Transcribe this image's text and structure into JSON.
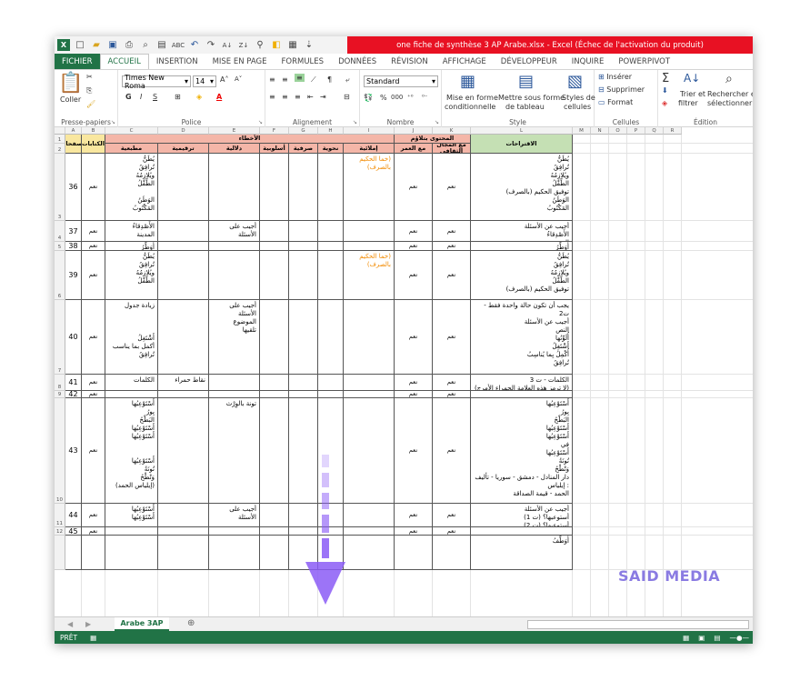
{
  "app": {
    "title": "one fiche de synthèse  3 AP Arabe.xlsx  -  Excel (Échec de l'activation du produit)",
    "logo": "X"
  },
  "qat": {
    "icons": [
      "new-file-icon",
      "open-folder-icon",
      "save-icon",
      "print-icon",
      "preview-icon",
      "print-preview-icon",
      "spelling-icon",
      "undo-icon",
      "redo-icon",
      "sort-asc-icon",
      "sort-desc-icon",
      "filter-icon",
      "fill-color-icon",
      "border-icon",
      "customize-icon"
    ]
  },
  "tabs": [
    "FICHIER",
    "ACCUEIL",
    "INSERTION",
    "MISE EN PAGE",
    "FORMULES",
    "DONNÉES",
    "RÉVISION",
    "AFFICHAGE",
    "DÉVELOPPEUR",
    "INQUIRE",
    "POWERPIVOT"
  ],
  "ribbon": {
    "paste_label": "Coller",
    "clipboard_label": "Presse-papiers",
    "font_name": "Times New Roma",
    "font_size": "14",
    "font_group_label": "Police",
    "bold": "G",
    "italic": "I",
    "underline": "S",
    "alignment_label": "Alignement",
    "number_format": "Standard",
    "percent": "%",
    "thousands": "000",
    "number_label": "Nombre",
    "cond_format_1": "Mise en forme",
    "cond_format_2": "conditionnelle",
    "table_format_1": "Mettre sous forme",
    "table_format_2": "de tableau",
    "cell_styles_1": "Styles de",
    "cell_styles_2": "cellules",
    "styles_label": "Style",
    "insert": "Insérer",
    "delete": "Supprimer",
    "format": "Format",
    "cells_label": "Cellules",
    "sort_1": "Trier et",
    "sort_2": "filtrer",
    "find_1": "Rechercher et",
    "find_2": "sélectionner",
    "editing_label": "Édition"
  },
  "columns": [
    "A",
    "B",
    "C",
    "D",
    "E",
    "F",
    "G",
    "H",
    "I",
    "J",
    "K",
    "L",
    "M",
    "N",
    "O",
    "P",
    "Q",
    "R"
  ],
  "rows": [
    "1",
    "2",
    "3",
    "4",
    "5",
    "6",
    "7",
    "8",
    "9",
    "10",
    "11",
    "12"
  ],
  "header": {
    "pages": "الصفحات",
    "notebooks": "الكتابات",
    "errors": "الأخطاء",
    "content": "المحتوى بتلاؤم",
    "with_cultural": "مع المجال الثقافي",
    "with_age": "مع العمر",
    "suggestions": "الاقتراحات",
    "typing": "مطبعية",
    "punctuation": "ترقيمية",
    "semantic": "دلالية",
    "style": "أسلوبية",
    "morph": "صرفية",
    "grammar": "نحوية",
    "spelling": "إملائية"
  },
  "data": [
    {
      "page": "36",
      "nb": "نعم",
      "c": "يُطَنُّ\nتُرافِقُ\nويُلازِمُهُ\nالطِّفْلُ\n\nالوَطَنُ\nالمَكْتُوبُ",
      "i": "(خما الحكيم بالصرف)",
      "j": "نعم",
      "k": "نعم",
      "l": "يُطَنُّ\nتُرافِقُ\nويُلازِمُهُ\nالطِّفْلُ\nتوفيق الحكيم (بالصرف)\nالوَطَنُ\nالمَكْتُوبُ"
    },
    {
      "page": "37",
      "nb": "نعم",
      "c": "الأَصْدِقاءُ\nالمدينة",
      "e": "أجيب على الأسئلة",
      "j": "نعم",
      "k": "نعم",
      "l": "أجيب عن الأسئلة\nالأَصْدِقاءُ\nالمدينة"
    },
    {
      "page": "38",
      "nb": "نعم",
      "c": "أُوَطِّرُ",
      "j": "نعم",
      "k": "نعم",
      "l": "أُوَطِّرُ"
    },
    {
      "page": "39",
      "nb": "نعم",
      "c": "يُطَنُّ\nتُرافِقُ\nويُلازِمُهُ\nالطِّفْلُ",
      "i": "(خما الحكيم بالصرف)",
      "j": "نعم",
      "k": "نعم",
      "l": "يُطَنُّ\nتُرافِقُ\nويُلازِمُهُ\nالطِّفْلُ\nتوفيق الحكيم (بالصرف)"
    },
    {
      "page": "40",
      "nb": "نعم",
      "c": "زيادة جدول\n\n\n\nأَشْتَغِلُ\nأكمل بما يناسب\nتُرافِقُ",
      "e": "أجيب على الأسئلة\nالموضوع\nتلقيها",
      "j": "نعم",
      "k": "نعم",
      "l": "يجب أن تكون حالة واحدة فقط - ت2\nأجيب عن الأسئلة\nالنص\nأُلَوِّنُها\nأَشْتَغِلُ\nأُكْمِلُ بِما يُناسِبُ\nتُرافِقُ"
    },
    {
      "page": "41",
      "nb": "نعم",
      "c": "الكلمات",
      "d": "نقاط حمراء",
      "j": "نعم",
      "k": "نعم",
      "l": "الكلمات - ت 3\n(لا ترمز هذه العلامة الحمراء الأمرج)"
    },
    {
      "page": "42",
      "nb": "نعم",
      "j": "نعم",
      "k": "نعم"
    },
    {
      "page": "43",
      "nb": "نعم",
      "c": "أَسْتَوْعِبُها\nبِورُ\nالبَطْحُ\nأَسْتَوْعِبُها\nأَسْتَوْعِبُها\n\n\nأَسْتَوْعِبُها\nتُونَةُ\nوَنْطْحُ\n(إيلياس الحمد)",
      "e": "تونة بالوِرْث",
      "j": "نعم",
      "k": "نعم",
      "l": "أَسْتَوْعِبُها\nبِورُ\nالبَطْحُ\nأَسْتَوْعِبُها\nأَسْتَوْعِبُها\nفي\nأَسْتَوْعِبُها\nتُونَةُ\nوَنْطْحُ\nدار المنادل - دمشق - سوريا - تأليف : إيلياس\nالحمد - قيمة الصداقة"
    },
    {
      "page": "44",
      "nb": "نعم",
      "c": "أَسْتَوْعِبُها\nأَسْتَوْعِبُها",
      "e": "أجيب على الأسئلة",
      "j": "نعم",
      "k": "نعم",
      "l": "أجيب عن الأسئلة\nأستوعبها؟ (ت 1)\nأستوعبها؟ (ت 2)"
    },
    {
      "page": "45",
      "nb": "نعم",
      "j": "نعم",
      "k": "نعم"
    },
    {
      "page": "",
      "nb": "",
      "l": "أُوَطِّفُ"
    }
  ],
  "watermark": "SAID MEDIA",
  "sheet_tab": "Arabe 3AP",
  "status": {
    "ready": "PRÊT"
  },
  "colors": {
    "excel_green": "#217346",
    "title_red": "#e81123",
    "errors_header": "#f4b6a8",
    "content_header": "#f4b6a8",
    "suggestions_header": "#c5e0b4",
    "pages_header": "#f9e79f",
    "arrow": "#8b5cf6"
  }
}
